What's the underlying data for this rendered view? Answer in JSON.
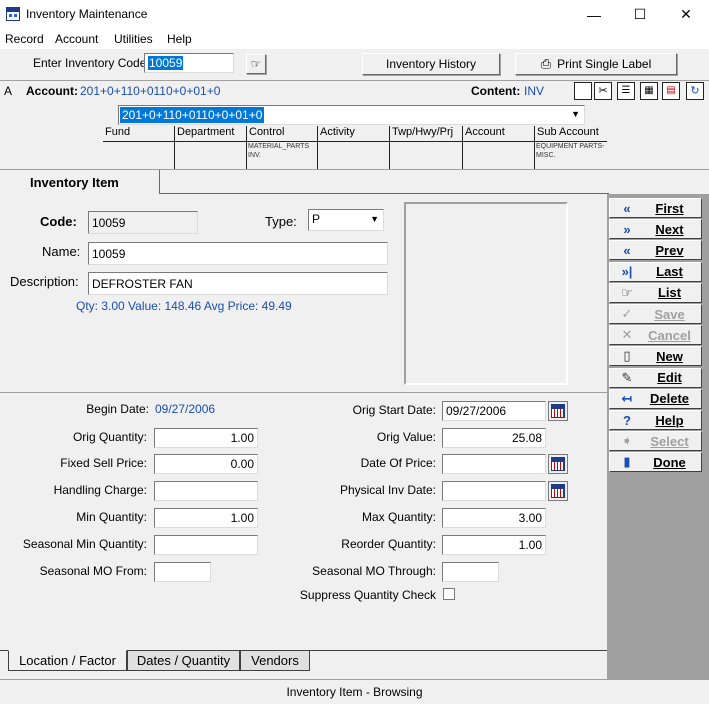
{
  "window": {
    "title": "Inventory Maintenance",
    "minimize": "—",
    "maximize": "☐",
    "close": "✕"
  },
  "menu": [
    "Record",
    "Account",
    "Utilities",
    "Help"
  ],
  "toolbar": {
    "code_label": "Enter Inventory Code:",
    "code_value": "10059",
    "history_button": "Inventory History",
    "print_button": "Print Single Label"
  },
  "account": {
    "prefix": "A",
    "label": "Account:",
    "value": "201+0+110+0110+0+01+0",
    "content_label": "Content:",
    "content_value": "INV",
    "dropdown_value": "201+0+110+0110+0+01+0"
  },
  "segments": {
    "headers": [
      "Fund",
      "Department",
      "Control",
      "Activity",
      "Twp/Hwy/Prj",
      "Account",
      "Sub Account"
    ],
    "control_desc": [
      "MATERIAL_PARTS",
      "INV."
    ],
    "subaccount_desc": "EQUIPMENT PARTS-MISC."
  },
  "section_tab": "Inventory Item",
  "item": {
    "code_label": "Code:",
    "code_value": "10059",
    "type_label": "Type:",
    "type_value": "P",
    "name_label": "Name:",
    "name_value": "10059",
    "desc_label": "Description:",
    "desc_value": "DEFROSTER FAN",
    "summary": "Qty: 3.00  Value: 148.46  Avg Price: 49.49"
  },
  "nav_buttons": [
    {
      "label": "First",
      "icon": "«",
      "disabled": false
    },
    {
      "label": "Next",
      "icon": "»",
      "disabled": false
    },
    {
      "label": "Prev",
      "icon": "«",
      "disabled": false
    },
    {
      "label": "Last",
      "icon": "»|",
      "disabled": false
    },
    {
      "label": "List",
      "icon": "☞",
      "disabled": false
    },
    {
      "label": "Save",
      "icon": "✓",
      "disabled": true
    },
    {
      "label": "Cancel",
      "icon": "✕",
      "disabled": true
    },
    {
      "label": "New",
      "icon": "▯",
      "disabled": false
    },
    {
      "label": "Edit",
      "icon": "✎",
      "disabled": false
    },
    {
      "label": "Delete",
      "icon": "↤",
      "disabled": false
    },
    {
      "label": "Help",
      "icon": "?",
      "disabled": false
    },
    {
      "label": "Select",
      "icon": "➧",
      "disabled": true
    },
    {
      "label": "Done",
      "icon": "▮",
      "disabled": false
    }
  ],
  "dates": {
    "begin_date_label": "Begin Date:",
    "begin_date": "09/27/2006",
    "orig_qty_label": "Orig Quantity:",
    "orig_qty": "1.00",
    "fixed_sell_label": "Fixed Sell Price:",
    "fixed_sell": "0.00",
    "handling_label": "Handling Charge:",
    "handling": "",
    "min_qty_label": "Min Quantity:",
    "min_qty": "1.00",
    "seasonal_min_label": "Seasonal Min Quantity:",
    "seasonal_min": "",
    "seasonal_from_label": "Seasonal MO From:",
    "seasonal_from": "",
    "orig_start_label": "Orig Start Date:",
    "orig_start": "09/27/2006",
    "orig_value_label": "Orig Value:",
    "orig_value": "25.08",
    "date_of_price_label": "Date Of Price:",
    "date_of_price": "",
    "phys_inv_label": "Physical Inv Date:",
    "phys_inv": "",
    "max_qty_label": "Max Quantity:",
    "max_qty": "3.00",
    "reorder_label": "Reorder Quantity:",
    "reorder": "1.00",
    "seasonal_through_label": "Seasonal MO Through:",
    "seasonal_through": "",
    "suppress_label": "Suppress Quantity Check"
  },
  "bottom_tabs": [
    "Location / Factor",
    "Dates / Quantity",
    "Vendors"
  ],
  "status": "Inventory Item - Browsing"
}
